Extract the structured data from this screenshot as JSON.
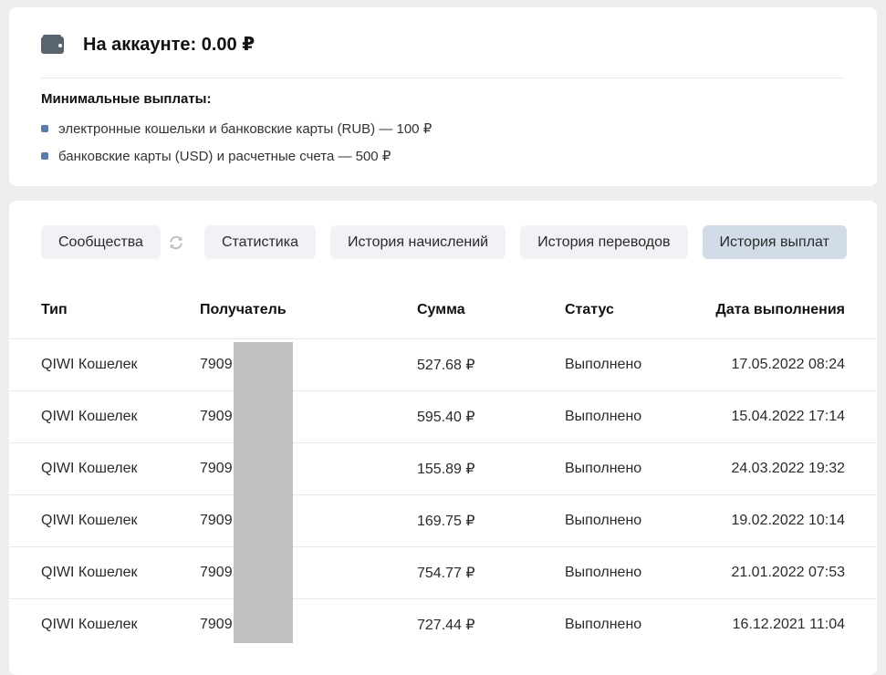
{
  "account": {
    "balance_text": "На аккаунте: 0.00 ₽",
    "min_payouts_title": "Минимальные выплаты:",
    "min_payouts": [
      "электронные кошельки и банковские карты (RUB) — 100 ₽",
      "банковские карты (USD) и расчетные счета — 500 ₽"
    ]
  },
  "tabs": [
    {
      "label": "Сообщества"
    },
    {
      "label": "Статистика"
    },
    {
      "label": "История начислений"
    },
    {
      "label": "История переводов"
    },
    {
      "label": "История выплат",
      "active": true
    }
  ],
  "table": {
    "headers": [
      "Тип",
      "Получатель",
      "Сумма",
      "Статус",
      "Дата выполнения"
    ],
    "rows": [
      {
        "type": "QIWI Кошелек",
        "recipient": "7909",
        "amount": "527.68 ₽",
        "status": "Выполнено",
        "date": "17.05.2022 08:24"
      },
      {
        "type": "QIWI Кошелек",
        "recipient": "7909",
        "amount": "595.40 ₽",
        "status": "Выполнено",
        "date": "15.04.2022 17:14"
      },
      {
        "type": "QIWI Кошелек",
        "recipient": "7909",
        "amount": "155.89 ₽",
        "status": "Выполнено",
        "date": "24.03.2022 19:32"
      },
      {
        "type": "QIWI Кошелек",
        "recipient": "7909",
        "amount": "169.75 ₽",
        "status": "Выполнено",
        "date": "19.02.2022 10:14"
      },
      {
        "type": "QIWI Кошелек",
        "recipient": "7909",
        "amount": "754.77 ₽",
        "status": "Выполнено",
        "date": "21.01.2022 07:53"
      },
      {
        "type": "QIWI Кошелек",
        "recipient": "7909",
        "amount": "727.44 ₽",
        "status": "Выполнено",
        "date": "16.12.2021 11:04"
      }
    ]
  },
  "colors": {
    "page_bg": "#edeef0",
    "tab_bg": "#f0f2f5",
    "tab_active_bg": "#d2dce9",
    "bullet": "#5b7ca8",
    "redaction": "#c0c0c0"
  },
  "icons": {
    "balance": "wallet-icon",
    "refresh": "refresh-icon"
  }
}
